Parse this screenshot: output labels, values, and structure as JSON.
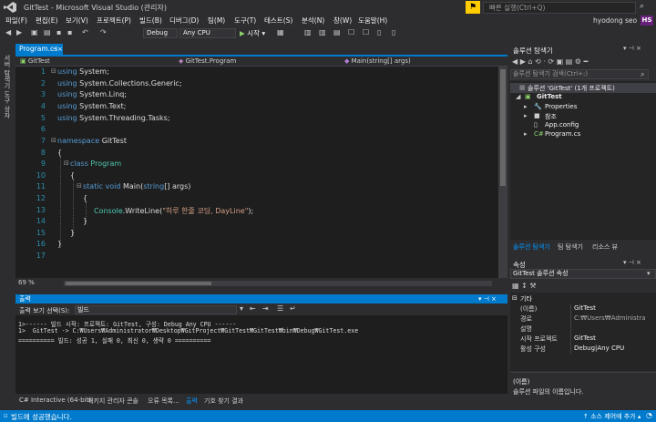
{
  "window": {
    "title": "GitTest - Microsoft Visual Studio (관리자)",
    "quick_launch_placeholder": "빠른 실행(Ctrl+Q)",
    "user_name": "hyodong seo",
    "user_initials": "HS"
  },
  "menu": [
    "파일(F)",
    "편집(E)",
    "보기(V)",
    "프로젝트(P)",
    "빌드(B)",
    "디버그(D)",
    "팀(M)",
    "도구(T)",
    "테스트(S)",
    "분석(N)",
    "창(W)",
    "도움말(H)"
  ],
  "toolbar": {
    "config": "Debug",
    "platform": "Any CPU",
    "start_label": "시작",
    "start_icon": "▶"
  },
  "left_strip": {
    "label": "서버 탐색기 도구 상자"
  },
  "editor": {
    "tab_label": "Program.cs",
    "nav_project": "GitTest",
    "nav_class": "GitTest.Program",
    "nav_member": "Main(string[] args)",
    "zoom": "69 %",
    "line_numbers": [
      "1",
      "2",
      "3",
      "4",
      "5",
      "6",
      "7",
      "8",
      "9",
      "10",
      "11",
      "12",
      "13",
      "14",
      "15",
      "16",
      "17"
    ],
    "code": {
      "l1_kw": "using",
      "l1_rest": " System;",
      "l2_kw": "using",
      "l2_rest": " System.Collections.Generic;",
      "l3_kw": "using",
      "l3_rest": " System.Linq;",
      "l4_kw": "using",
      "l4_rest": " System.Text;",
      "l5_kw": "using",
      "l5_rest": " System.Threading.Tasks;",
      "l7_kw": "namespace",
      "l7_rest": " GitTest",
      "l8": "{",
      "l9_kw": "class",
      "l9_ty": "Program",
      "l10": "{",
      "l11_kw1": "static",
      "l11_kw2": "void",
      "l11_name": "Main(",
      "l11_kw3": "string",
      "l11_rest": "[] args)",
      "l12": "{",
      "l13_ty": "Console",
      "l13_mid": ".WriteLine(",
      "l13_str": "\"하루 한줄 코딩, DayLine\"",
      "l13_end": ");",
      "l14": "}",
      "l15": "}",
      "l16": "}"
    }
  },
  "output": {
    "title": "출력",
    "source_label": "출력 보기 선택(S):",
    "source_value": "빌드",
    "lines": [
      "1>------ 빌드 시작: 프로젝트: GitTest, 구성: Debug Any CPU ------",
      "1>  GitTest -> C:₩Users₩Administrator₩Desktop₩GitProject₩GitTest₩GitTest₩bin₩Debug₩GitTest.exe",
      "========== 빌드: 성공 1, 실패 0, 최신 0, 생략 0 =========="
    ]
  },
  "bottom_tabs": [
    "C# Interactive (64-bit)",
    "패키지 관리자 콘솔",
    "오류 목록...",
    "출력",
    "기호 찾기 결과"
  ],
  "status": {
    "text": "빌드에 성공했습니다.",
    "right": "↑ 소스 제어에 추가 ▴"
  },
  "solution_explorer": {
    "title": "솔루션 탐색기",
    "search_placeholder": "솔루션 탐색기 검색(Ctrl+;)",
    "solution": "솔루션 'GitTest' (1개 프로젝트)",
    "project": "GitTest",
    "items": [
      "Properties",
      "참조",
      "App.config",
      "Program.cs"
    ]
  },
  "side_tabs": [
    "솔루션 탐색기",
    "팀 탐색기",
    "리소스 뷰"
  ],
  "properties": {
    "title": "속성",
    "object": "GitTest 솔루션 속성",
    "category": "기타",
    "rows": [
      {
        "name": "(이름)",
        "value": "GitTest"
      },
      {
        "name": "경로",
        "value": "C:₩Users₩Administra"
      },
      {
        "name": "설명",
        "value": ""
      },
      {
        "name": "시작 프로젝트",
        "value": "GitTest"
      },
      {
        "name": "활성 구성",
        "value": "Debug|Any CPU"
      }
    ],
    "desc_name": "(이름)",
    "desc_text": "솔루션 파일의 이름입니다."
  },
  "colors": {
    "accent": "#007acc",
    "background": "#2d2d30",
    "editor_bg": "#1e1e1e",
    "keyword": "#569cd6",
    "type": "#4ec9b0",
    "string": "#d69d85",
    "line_number": "#2b91af"
  },
  "icons": [
    "vs-logo-icon",
    "notification-flag-icon",
    "search-icon",
    "play-icon",
    "pin-icon",
    "close-icon",
    "solution-icon",
    "project-icon",
    "wrench-icon",
    "reference-icon",
    "config-file-icon",
    "csharp-file-icon",
    "chevron-down-icon",
    "check-icon"
  ]
}
